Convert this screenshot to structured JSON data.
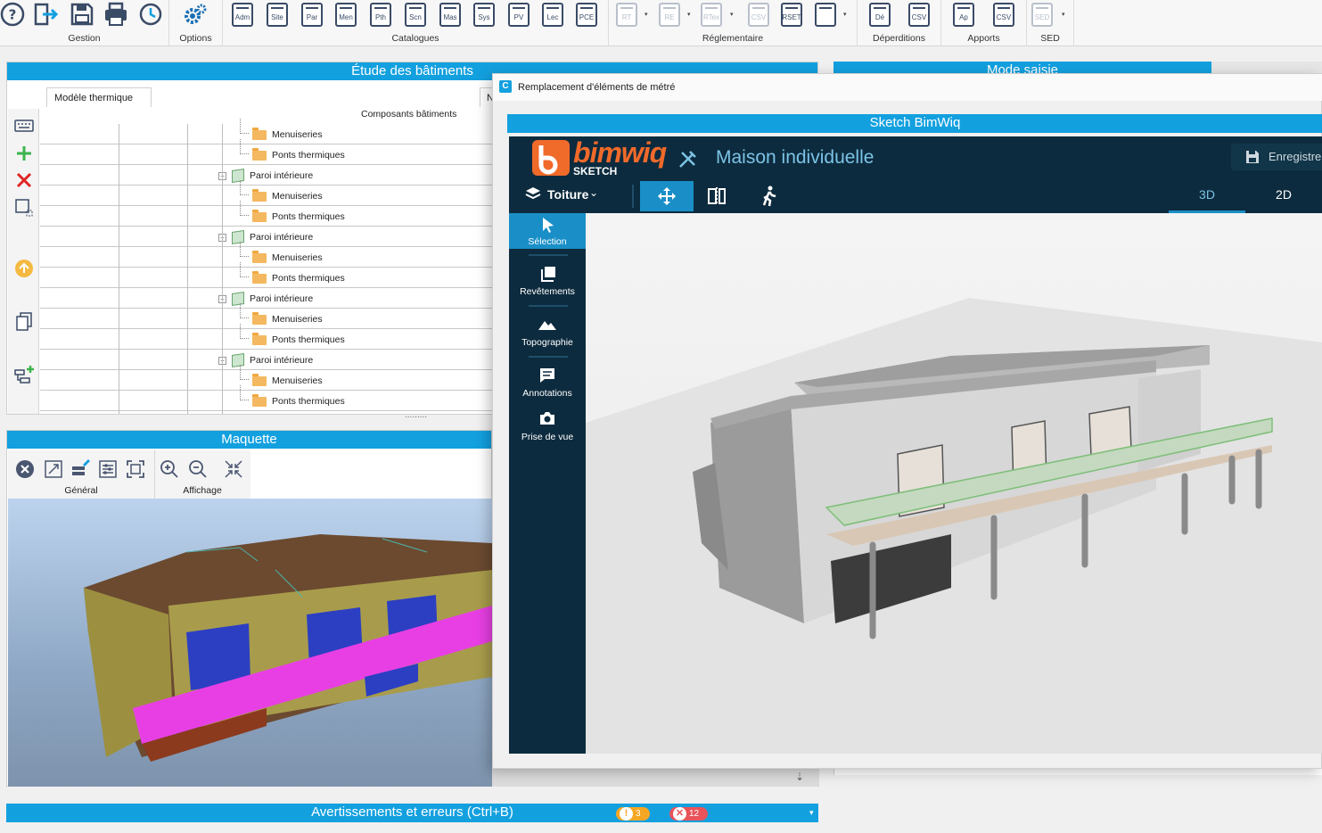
{
  "ribbon": {
    "groups": {
      "gestion": "Gestion",
      "options": "Options",
      "catalogues": "Catalogues",
      "reglementaire": "Réglementaire",
      "deperditions": "Déperditions",
      "apports": "Apports",
      "sed": "SED"
    },
    "catalogue_items": [
      "Adm",
      "Site",
      "Par",
      "Men",
      "Pth",
      "Scn",
      "Mas",
      "Sys",
      "PV",
      "Lec",
      "PCE"
    ],
    "regl_items": [
      "RT",
      "RE",
      "RTex",
      "CSV",
      "RSET",
      ""
    ],
    "deperd_items": [
      "Dé",
      "CSV"
    ],
    "apports_items": [
      "Ap",
      "CSV"
    ],
    "sed_items": [
      "SED"
    ]
  },
  "etude": {
    "title": "Étude des bâtiments",
    "tab": "Modèle thermique",
    "tab2": "N",
    "column_header": "Composants bâtiments",
    "rows": [
      {
        "type": "child",
        "label": "Menuiseries"
      },
      {
        "type": "child",
        "label": "Ponts thermiques"
      },
      {
        "type": "parent",
        "label": "Paroi intérieure"
      },
      {
        "type": "child",
        "label": "Menuiseries"
      },
      {
        "type": "child",
        "label": "Ponts thermiques"
      },
      {
        "type": "parent",
        "label": "Paroi intérieure"
      },
      {
        "type": "child",
        "label": "Menuiseries"
      },
      {
        "type": "child",
        "label": "Ponts thermiques"
      },
      {
        "type": "parent",
        "label": "Paroi intérieure"
      },
      {
        "type": "child",
        "label": "Menuiseries"
      },
      {
        "type": "child",
        "label": "Ponts thermiques"
      },
      {
        "type": "parent",
        "label": "Paroi intérieure"
      },
      {
        "type": "child",
        "label": "Menuiseries"
      },
      {
        "type": "child",
        "label": "Ponts thermiques"
      }
    ],
    "splitter": "........."
  },
  "mode": {
    "title": "Mode saisie"
  },
  "maquette": {
    "title": "Maquette",
    "group_general": "Général",
    "group_affichage": "Affichage"
  },
  "warnings": {
    "title": "Avertissements et erreurs (Ctrl+B)",
    "warning_count": "3",
    "error_count": "12"
  },
  "dialog": {
    "title": "Remplacement d'éléments de métré",
    "sketch_title": "Sketch BimWiq",
    "app": {
      "logo_main": "bimwiq",
      "logo_sub": "SKETCH",
      "project_name": "Maison individuelle",
      "save_label": "Enregistre",
      "layer_label": "Toiture",
      "tab_3d": "3D",
      "tab_2d": "2D",
      "sidebar": [
        "Sélection",
        "Revêtements",
        "Topographie",
        "Annotations",
        "Prise de vue"
      ]
    }
  },
  "colors": {
    "accent": "#13a0df",
    "app_bg": "#0d2b3e",
    "app_title": "#7cc3e6",
    "warning": "#f5a623",
    "error": "#e8545a",
    "active_tool": "#1a8fc7"
  }
}
